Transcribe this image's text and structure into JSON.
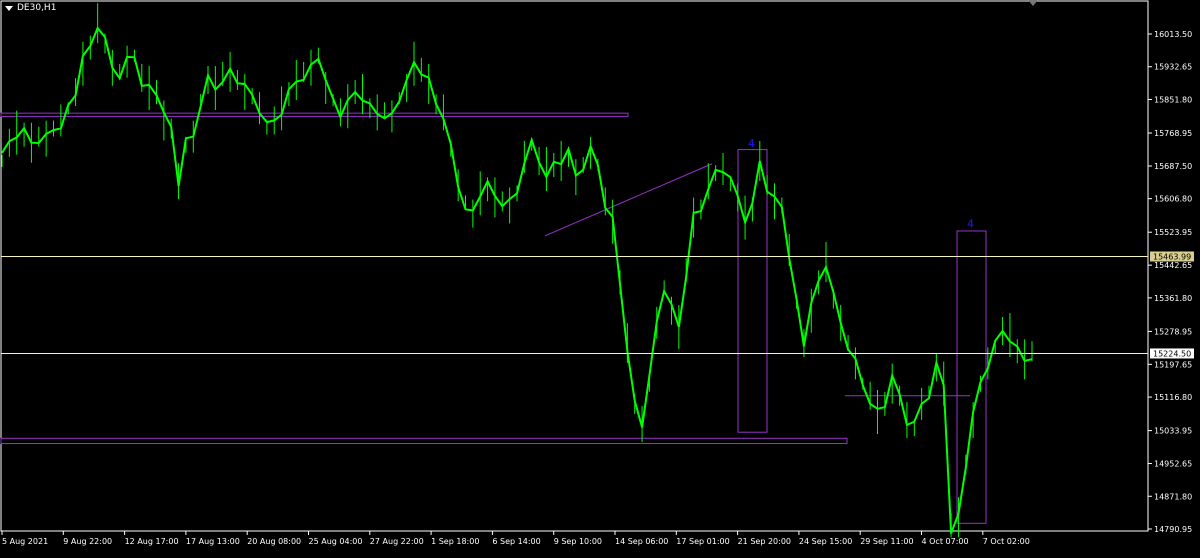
{
  "window": {
    "symbol_label": "DE30,H1"
  },
  "colors": {
    "background": "#000000",
    "candle": "#00ff00",
    "axis": "#ffffff",
    "hline": "#f5f5c0",
    "drawing": "#9932cc",
    "label_marker": "#1a1aff",
    "bid_label_bg": "#d8cf8f"
  },
  "chart_data": {
    "type": "line",
    "title": "DE30,H1",
    "xlabel": "",
    "ylabel": "",
    "ylim": [
      14750,
      16075
    ],
    "y_ticks": [
      16013.5,
      15932.65,
      15851.8,
      15768.95,
      15687.5,
      15606.8,
      15523.95,
      15442.65,
      15361.8,
      15278.95,
      15197.65,
      15116.8,
      15033.95,
      14952.65,
      14871.8,
      14790.95
    ],
    "x_tick_labels": [
      "5 Aug 2021",
      "9 Aug 22:00",
      "12 Aug 17:00",
      "17 Aug 13:00",
      "20 Aug 08:00",
      "25 Aug 04:00",
      "27 Aug 22:00",
      "1 Sep 18:00",
      "6 Sep 14:00",
      "9 Sep 10:00",
      "14 Sep 06:00",
      "17 Sep 01:00",
      "21 Sep 20:00",
      "24 Sep 15:00",
      "29 Sep 11:00",
      "4 Oct 07:00",
      "7 Oct 02:00"
    ],
    "series": [
      {
        "values": [
          15700,
          15745,
          15770,
          15765,
          15745,
          15760,
          15755,
          15780,
          15800,
          15830,
          15870,
          15940,
          15980,
          16040,
          15990,
          15930,
          15920,
          15945,
          15960,
          15905,
          15880,
          15870,
          15800,
          15780,
          15650,
          15740,
          15760,
          15850,
          15900,
          15880,
          15915,
          15920,
          15900,
          15870,
          15860,
          15830,
          15780,
          15800,
          15830,
          15865,
          15900,
          15920,
          15930,
          15960,
          15880,
          15850,
          15820,
          15835,
          15870,
          15865,
          15830,
          15820,
          15825,
          15810,
          15855,
          15880,
          15940,
          15925,
          15890,
          15840,
          15820,
          15730,
          15640,
          15600,
          15570,
          15620,
          15630,
          15610,
          15600,
          15590,
          15620,
          15710,
          15740,
          15700,
          15680,
          15690,
          15700,
          15710,
          15660,
          15690,
          15720,
          15690,
          15600,
          15550,
          15400,
          15250,
          15100,
          15050,
          15150,
          15300,
          15390,
          15330,
          15290,
          15430,
          15560,
          15580,
          15650,
          15670,
          15680,
          15640,
          15610,
          15560,
          15580,
          15700,
          15640,
          15600,
          15590,
          15480,
          15350,
          15250,
          15330,
          15400,
          15450,
          15360,
          15300,
          15250,
          15200,
          15150,
          15120,
          15080,
          15100,
          15150,
          15120,
          15060,
          15040,
          15100,
          15130,
          15190,
          15150,
          14800,
          14820,
          14950,
          15060,
          15150,
          15200,
          15240,
          15280,
          15270,
          15230,
          15210,
          15230
        ]
      }
    ],
    "current_bid": "15463.99",
    "current_price": "15224.50",
    "hlines": [
      15463.99,
      15224.5
    ],
    "markers": [
      "4",
      "4"
    ],
    "grid": false,
    "legend": "none"
  }
}
